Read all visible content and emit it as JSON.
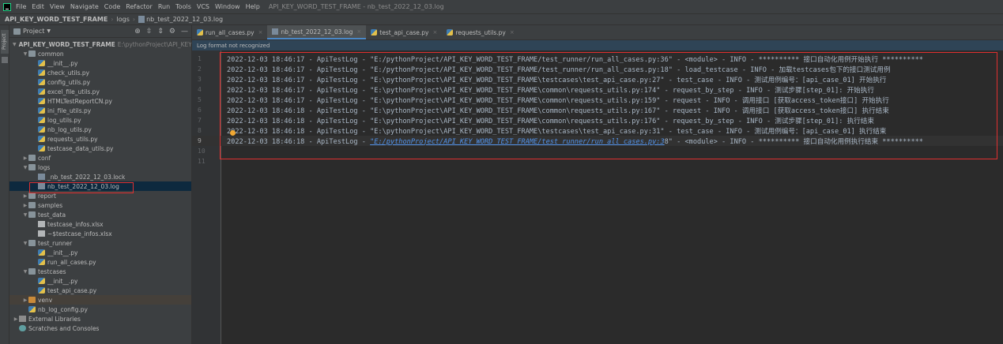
{
  "menubar": {
    "items": [
      "File",
      "Edit",
      "View",
      "Navigate",
      "Code",
      "Refactor",
      "Run",
      "Tools",
      "VCS",
      "Window",
      "Help"
    ],
    "window_title": "API_KEY_WORD_TEST_FRAME - nb_test_2022_12_03.log"
  },
  "navbar": {
    "project": "API_KEY_WORD_TEST_FRAME",
    "folder": "logs",
    "file": "nb_test_2022_12_03.log"
  },
  "toolstrip": {
    "label": "Project"
  },
  "project_panel": {
    "title": "Project",
    "root_name": "API_KEY_WORD_TEST_FRAME",
    "root_path": "E:\\pythonProject\\API_KEY",
    "items": [
      {
        "label": "common",
        "depth": 1,
        "type": "folder",
        "expanded": true
      },
      {
        "label": "__init__.py",
        "depth": 2,
        "type": "py"
      },
      {
        "label": "check_utils.py",
        "depth": 2,
        "type": "py"
      },
      {
        "label": "config_utils.py",
        "depth": 2,
        "type": "py"
      },
      {
        "label": "excel_file_utils.py",
        "depth": 2,
        "type": "py"
      },
      {
        "label": "HTMLTestReportCN.py",
        "depth": 2,
        "type": "py"
      },
      {
        "label": "ini_file_utils.py",
        "depth": 2,
        "type": "py"
      },
      {
        "label": "log_utils.py",
        "depth": 2,
        "type": "py"
      },
      {
        "label": "nb_log_utils.py",
        "depth": 2,
        "type": "py"
      },
      {
        "label": "requests_utils.py",
        "depth": 2,
        "type": "py"
      },
      {
        "label": "testcase_data_utils.py",
        "depth": 2,
        "type": "py"
      },
      {
        "label": "conf",
        "depth": 1,
        "type": "folder",
        "expanded": false
      },
      {
        "label": "logs",
        "depth": 1,
        "type": "folder",
        "expanded": true
      },
      {
        "label": "_nb_test_2022_12_03.lock",
        "depth": 2,
        "type": "log"
      },
      {
        "label": "nb_test_2022_12_03.log",
        "depth": 2,
        "type": "log",
        "selected": true
      },
      {
        "label": "report",
        "depth": 1,
        "type": "folder",
        "expanded": false
      },
      {
        "label": "samples",
        "depth": 1,
        "type": "folder",
        "expanded": false
      },
      {
        "label": "test_data",
        "depth": 1,
        "type": "folder",
        "expanded": true
      },
      {
        "label": "testcase_infos.xlsx",
        "depth": 2,
        "type": "xls"
      },
      {
        "label": "~$testcase_infos.xlsx",
        "depth": 2,
        "type": "xls"
      },
      {
        "label": "test_runner",
        "depth": 1,
        "type": "folder",
        "expanded": true
      },
      {
        "label": "__init__.py",
        "depth": 2,
        "type": "py"
      },
      {
        "label": "run_all_cases.py",
        "depth": 2,
        "type": "py"
      },
      {
        "label": "testcases",
        "depth": 1,
        "type": "folder",
        "expanded": true
      },
      {
        "label": "__init__.py",
        "depth": 2,
        "type": "py"
      },
      {
        "label": "test_api_case.py",
        "depth": 2,
        "type": "py"
      },
      {
        "label": "venv",
        "depth": 1,
        "type": "folder-orange",
        "expanded": false,
        "venv": true
      },
      {
        "label": "nb_log_config.py",
        "depth": 1,
        "type": "py"
      },
      {
        "label": "External Libraries",
        "depth": 0,
        "type": "lib",
        "expanded": false
      },
      {
        "label": "Scratches and Consoles",
        "depth": 0,
        "type": "scratch"
      }
    ]
  },
  "tabs": [
    {
      "label": "run_all_cases.py",
      "type": "py",
      "active": false
    },
    {
      "label": "nb_test_2022_12_03.log",
      "type": "log",
      "active": true
    },
    {
      "label": "test_api_case.py",
      "type": "py",
      "active": false
    },
    {
      "label": "requests_utils.py",
      "type": "py",
      "active": false
    }
  ],
  "notice": "Log format not recognized",
  "code_lines": [
    "2022-12-03 18:46:17 - ApiTestLog - \"E:/pythonProject/API_KEY_WORD_TEST_FRAME/test_runner/run_all_cases.py:36\" - <module> - INFO - ********** 接口自动化用例开始执行 **********",
    "2022-12-03 18:46:17 - ApiTestLog - \"E:/pythonProject/API_KEY_WORD_TEST_FRAME/test_runner/run_all_cases.py:18\" - load_testcase - INFO - 加载testcases包下的接口测试用例",
    "2022-12-03 18:46:17 - ApiTestLog - \"E:\\pythonProject\\API_KEY_WORD_TEST_FRAME\\testcases\\test_api_case.py:27\" - test_case - INFO - 测试用例编号：[api_case_01] 开始执行",
    "2022-12-03 18:46:17 - ApiTestLog - \"E:\\pythonProject\\API_KEY_WORD_TEST_FRAME\\common\\requests_utils.py:174\" - request_by_step - INFO - 测试步骤[step_01]: 开始执行",
    "2022-12-03 18:46:17 - ApiTestLog - \"E:\\pythonProject\\API_KEY_WORD_TEST_FRAME\\common\\requests_utils.py:159\" - request - INFO - 调用接口 [获取access_token接口] 开始执行",
    "2022-12-03 18:46:18 - ApiTestLog - \"E:\\pythonProject\\API_KEY_WORD_TEST_FRAME\\common\\requests_utils.py:167\" - request - INFO - 调用接口 [获取access_token接口] 执行结束",
    "2022-12-03 18:46:18 - ApiTestLog - \"E:\\pythonProject\\API_KEY_WORD_TEST_FRAME\\common\\requests_utils.py:176\" - request_by_step - INFO - 测试步骤[step_01]: 执行结束",
    "2022-12-03 18:46:18 - ApiTestLog - \"E:\\pythonProject\\API_KEY_WORD_TEST_FRAME\\testcases\\test_api_case.py:31\" - test_case - INFO - 测试用例编号：[api_case_01] 执行结束",
    "",
    "",
    ""
  ],
  "line9": {
    "prefix": "2022-12-03 18:46:18 - ApiTestLog - ",
    "link": "\"E:/pythonProject/API_KEY_WORD_TEST_FRAME/test_runner/run_all_cases.py:3",
    "suffix": "8\" - <module> - INFO - ********** 接口自动化用例执行结束 **********"
  },
  "line_numbers": [
    "1",
    "2",
    "3",
    "4",
    "5",
    "6",
    "7",
    "8",
    "9",
    "10",
    "11"
  ]
}
